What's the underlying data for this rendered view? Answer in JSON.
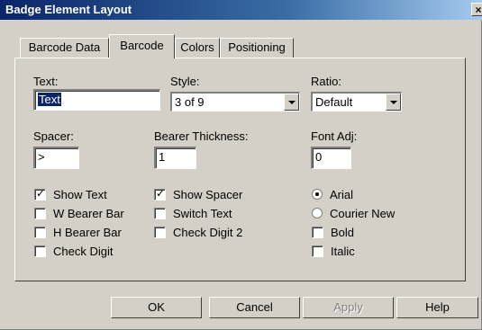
{
  "window": {
    "title": "Badge Element Layout",
    "close_glyph": "×"
  },
  "tabs": [
    {
      "label": "Barcode Data"
    },
    {
      "label": "Barcode"
    },
    {
      "label": "Colors"
    },
    {
      "label": "Positioning"
    }
  ],
  "active_tab": "Barcode",
  "fields": {
    "text": {
      "label": "Text:",
      "value": "Text"
    },
    "style": {
      "label": "Style:",
      "value": "3 of 9"
    },
    "ratio": {
      "label": "Ratio:",
      "value": "Default"
    },
    "spacer": {
      "label": "Spacer:",
      "value": ">"
    },
    "bearer_thickness": {
      "label": "Bearer Thickness:",
      "value": "1"
    },
    "font_adj": {
      "label": "Font Adj:",
      "value": "0"
    }
  },
  "checkboxes": {
    "show_text": {
      "label": "Show Text",
      "checked": true
    },
    "w_bearer_bar": {
      "label": "W Bearer Bar",
      "checked": false
    },
    "h_bearer_bar": {
      "label": "H Bearer Bar",
      "checked": false
    },
    "check_digit": {
      "label": "Check Digit",
      "checked": false
    },
    "show_spacer": {
      "label": "Show Spacer",
      "checked": true
    },
    "switch_text": {
      "label": "Switch Text",
      "checked": false
    },
    "check_digit_2": {
      "label": "Check Digit 2",
      "checked": false
    },
    "bold": {
      "label": "Bold",
      "checked": false
    },
    "italic": {
      "label": "Italic",
      "checked": false
    }
  },
  "font_radios": {
    "arial": {
      "label": "Arial",
      "selected": true
    },
    "courier_new": {
      "label": "Courier New",
      "selected": false
    }
  },
  "buttons": {
    "ok": "OK",
    "cancel": "Cancel",
    "apply": "Apply",
    "help": "Help"
  }
}
